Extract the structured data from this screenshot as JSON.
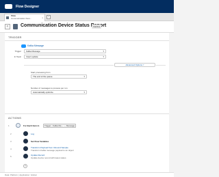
{
  "app": {
    "title": "Flow Designer"
  },
  "tab": {
    "title": "Flow",
    "subtitle": "Communication Devi...",
    "close": "x",
    "add": "+"
  },
  "header": {
    "back": "<",
    "title": "Communication Device Status Report",
    "badge": "Inactive"
  },
  "trigger": {
    "section_label": "TRIGGER",
    "source": "Kafka Message",
    "fields": [
      {
        "label": "Trigger",
        "value": "Kafka Message"
      },
      {
        "label": "In Topic",
        "value": "Insert update"
      }
    ],
    "advanced_label": "Advanced Options",
    "start_processing_label": "Start processing from",
    "start_processing_value": "The end of the queue",
    "batch_label": "Number of messages to process per run",
    "batch_value": "Automatically optimize"
  },
  "actions": {
    "section_label": "ACTIONS",
    "foreach": {
      "num": "1",
      "text": "For Each Item in",
      "pill": "Trigger - Kafka Me... → Message"
    },
    "items": [
      {
        "num": "2",
        "title": "Log",
        "detail": ""
      },
      {
        "num": "3",
        "title": "Set Flow Variables",
        "detail": ""
      },
      {
        "num": "4",
        "title": "Transform Payload from Inbound Sample",
        "detail": "Transform Kafka message payload to an object"
      },
      {
        "num": "5",
        "title": "Update Record",
        "detail": "Update device record with latest status"
      }
    ]
  },
  "footer": {
    "text": "Data: Platform  |  Application: Global"
  }
}
